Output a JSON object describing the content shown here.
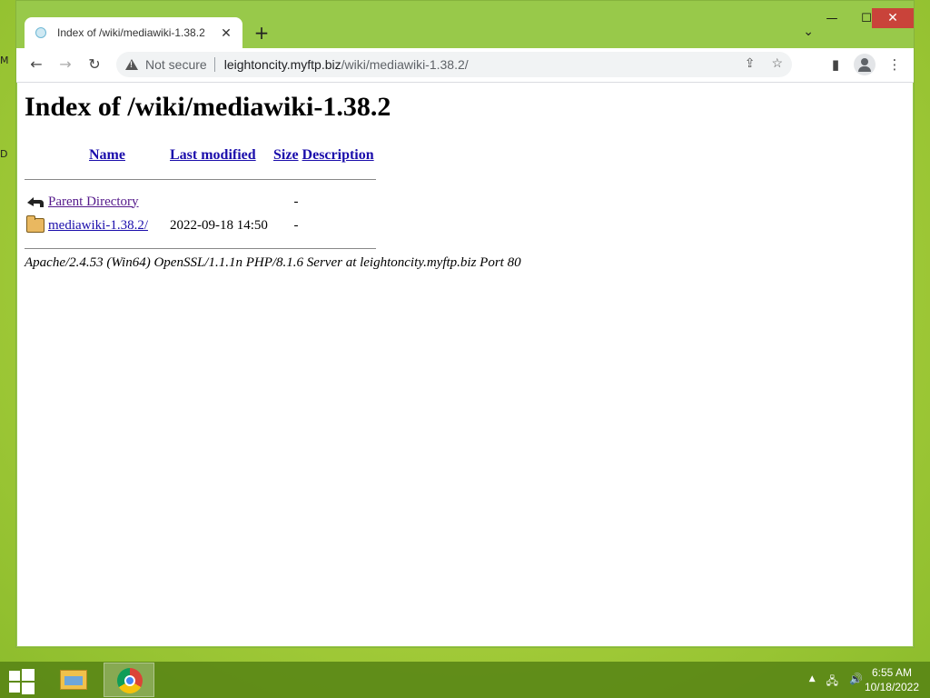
{
  "desktop": {
    "edge_labels": [
      "M",
      "D"
    ]
  },
  "browser": {
    "tab": {
      "title": "Index of /wiki/mediawiki-1.38.2",
      "close": "✕"
    },
    "new_tab": "+",
    "tab_menu": "⌄",
    "window_controls": {
      "minimize": "—",
      "maximize": "☐",
      "close": "✕"
    },
    "nav": {
      "back": "←",
      "forward": "→",
      "reload": "↻"
    },
    "address": {
      "security": "Not secure",
      "host": "leightoncity.myftp.biz",
      "path": "/wiki/mediawiki-1.38.2/"
    },
    "toolbar_icons": {
      "share": "⇪",
      "bookmark": "☆",
      "side_panel": "▮",
      "menu": "⋮"
    }
  },
  "page": {
    "title": "Index of /wiki/mediawiki-1.38.2",
    "columns": {
      "name": "Name",
      "last_modified": "Last modified",
      "size": "Size",
      "description": "Description"
    },
    "entries": [
      {
        "name": "Parent Directory",
        "modified": "",
        "size": "-",
        "description": "",
        "icon": "back-arrow-icon"
      },
      {
        "name": "mediawiki-1.38.2/",
        "modified": "2022-09-18 14:50",
        "size": "-",
        "description": "",
        "icon": "folder-icon"
      }
    ],
    "server_signature": "Apache/2.4.53 (Win64) OpenSSL/1.1.1n PHP/8.1.6 Server at leightoncity.myftp.biz Port 80"
  },
  "taskbar": {
    "apps": [
      "file-explorer-icon",
      "chrome-icon"
    ],
    "tray": {
      "chevron": "▲",
      "network": "🖧",
      "volume": "🔊"
    },
    "clock": {
      "time": "6:55 AM",
      "date": "10/18/2022"
    }
  },
  "colors": {
    "desktop": "#a4cc3a",
    "window_frame": "#98c94a",
    "link": "#1a0dab",
    "visited_link": "#551a8b",
    "close_button": "#c9433a"
  }
}
